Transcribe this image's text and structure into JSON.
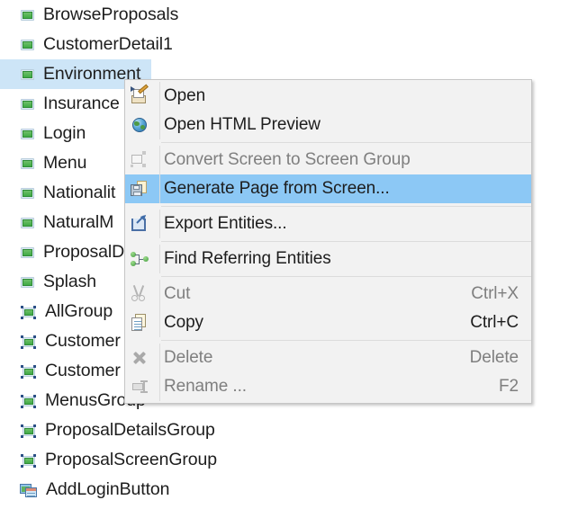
{
  "tree": {
    "items": [
      {
        "label": "BrowseProposals",
        "icon": "screen-icon",
        "selected": false
      },
      {
        "label": "CustomerDetail1",
        "icon": "screen-icon",
        "selected": false
      },
      {
        "label": "Environment",
        "icon": "screen-icon",
        "selected": true
      },
      {
        "label": "Insurance",
        "icon": "screen-icon",
        "selected": false
      },
      {
        "label": "Login",
        "icon": "screen-icon",
        "selected": false
      },
      {
        "label": "Menu",
        "icon": "screen-icon",
        "selected": false
      },
      {
        "label": "Nationalit",
        "icon": "screen-icon",
        "selected": false
      },
      {
        "label": "NaturalM",
        "icon": "screen-icon",
        "selected": false
      },
      {
        "label": "ProposalD",
        "icon": "screen-icon",
        "selected": false
      },
      {
        "label": "Splash",
        "icon": "screen-icon",
        "selected": false
      },
      {
        "label": "AllGroup",
        "icon": "screen-group-icon",
        "selected": false
      },
      {
        "label": "Customer",
        "icon": "screen-group-icon",
        "selected": false
      },
      {
        "label": "Customer",
        "icon": "screen-group-icon",
        "selected": false
      },
      {
        "label": "MenusGroup",
        "icon": "screen-group-icon",
        "selected": false
      },
      {
        "label": "ProposalDetailsGroup",
        "icon": "screen-group-icon",
        "selected": false
      },
      {
        "label": "ProposalScreenGroup",
        "icon": "screen-group-icon",
        "selected": false
      },
      {
        "label": "AddLoginButton",
        "icon": "window-pair-icon",
        "selected": false
      }
    ]
  },
  "context_menu": {
    "items": [
      {
        "label": "Open",
        "accel": "",
        "icon": "open-editor-icon",
        "disabled": false,
        "highlighted": false,
        "separator_after": false
      },
      {
        "label": "Open HTML Preview",
        "accel": "",
        "icon": "globe-icon",
        "disabled": false,
        "highlighted": false,
        "separator_after": true
      },
      {
        "label": "Convert Screen to Screen Group",
        "accel": "",
        "icon": "convert-screen-icon",
        "disabled": true,
        "highlighted": false,
        "separator_after": false
      },
      {
        "label": "Generate Page from Screen...",
        "accel": "",
        "icon": "generate-page-icon",
        "disabled": false,
        "highlighted": true,
        "separator_after": true
      },
      {
        "label": "Export Entities...",
        "accel": "",
        "icon": "export-icon",
        "disabled": false,
        "highlighted": false,
        "separator_after": true
      },
      {
        "label": "Find Referring Entities",
        "accel": "",
        "icon": "find-referring-icon",
        "disabled": false,
        "highlighted": false,
        "separator_after": true
      },
      {
        "label": "Cut",
        "accel": "Ctrl+X",
        "icon": "cut-icon",
        "disabled": true,
        "highlighted": false,
        "separator_after": false
      },
      {
        "label": "Copy",
        "accel": "Ctrl+C",
        "icon": "copy-icon",
        "disabled": false,
        "highlighted": false,
        "separator_after": true
      },
      {
        "label": "Delete",
        "accel": "Delete",
        "icon": "delete-icon",
        "disabled": true,
        "highlighted": false,
        "separator_after": false
      },
      {
        "label": "Rename ...",
        "accel": "F2",
        "icon": "rename-icon",
        "disabled": true,
        "highlighted": false,
        "separator_after": false
      }
    ]
  },
  "colors": {
    "menu_background": "#f2f2f2",
    "menu_border": "#c6c6c6",
    "highlight": "#8cc8f5",
    "tree_selection": "#cde5f7",
    "text": "#1d1d1d",
    "disabled_text": "#7f7f7f",
    "separator": "#dcdcdc"
  }
}
